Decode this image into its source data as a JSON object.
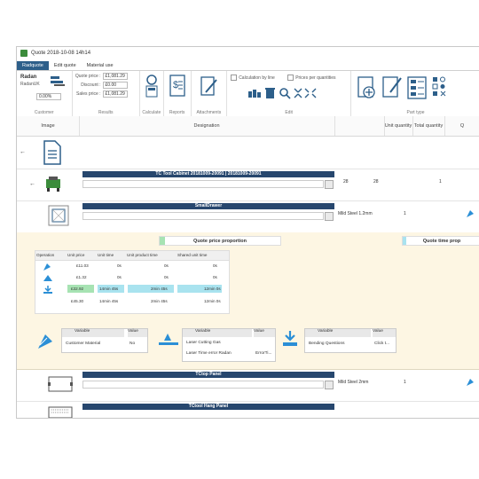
{
  "window": {
    "title": "Quote 2018-10-08 14h14"
  },
  "menu_tabs": [
    {
      "label": "Radquote",
      "active": true
    },
    {
      "label": "Edit quote",
      "active": false
    },
    {
      "label": "Material use",
      "active": false
    }
  ],
  "customer": {
    "name": "Radan",
    "sub": "RadanUK",
    "percent": "0.00%",
    "group_label": "Customer"
  },
  "results": {
    "quote_price_label": "Quote price :",
    "quote_price_value": "£1,081.29",
    "discount_label": "Discount :",
    "discount_value": "£0.00",
    "sales_price_label": "Sales price :",
    "sales_price_value": "£1,081.29",
    "group_label": "Results"
  },
  "ribbon_groups": {
    "calculate": "Calculate",
    "reports": "Reports",
    "attachments": "Attachments",
    "edit": "Edit",
    "part_type": "Part type"
  },
  "options": {
    "calc_by_line": "Calculation by line",
    "prices_per_qty": "Prices per quantities"
  },
  "grid_headers": {
    "image": "Image",
    "designation": "Designation",
    "unit_quantity": "Unit quantity",
    "total_quantity": "Total quantity",
    "more": "Q"
  },
  "rows": {
    "assembly": {
      "title": "TC Tool Cabinet 20181009-20091 | 20181009-20091",
      "unit_qty": "28",
      "total_qty": "28",
      "c1": "1"
    },
    "part1": {
      "title": "SmallDrawer",
      "material": "Mild Steel 1.2mm",
      "qty": "1"
    },
    "part2": {
      "title": "TCtop Panel",
      "material": "Mild Steel 2mm",
      "qty": "1"
    },
    "part3": {
      "title": "TCtool Hang Panel"
    }
  },
  "panel": {
    "price_proportion": "Quote price proportion",
    "time_proportion": "Quote time prop",
    "op_headers": {
      "operation": "Operation",
      "unit_price": "Unit price",
      "unit_time": "Unit time",
      "unit_product_time": "Unit product time",
      "shared_unit_time": "Shared unit time"
    },
    "op_rows": [
      {
        "price": "£11.03",
        "time": "0s",
        "ptime": "0s",
        "stime": "0s"
      },
      {
        "price": "£1.32",
        "time": "0s",
        "ptime": "0s",
        "stime": "0s"
      },
      {
        "price": "£32.92",
        "time": "14min 45s",
        "ptime": "2min 45s",
        "stime": "12min 0s"
      },
      {
        "price": "£45.30",
        "time": "14min 45s",
        "ptime": "2min 45s",
        "stime": "12min 0s"
      }
    ],
    "var_tables": [
      {
        "h1": "Variable",
        "h2": "Value",
        "rows": [
          [
            "Customer Material",
            "No"
          ]
        ]
      },
      {
        "h1": "Variable",
        "h2": "Value",
        "rows": [
          [
            "Laser Cutting Gas",
            ""
          ],
          [
            "Laser Time error Radan",
            "ErrorTi..."
          ]
        ]
      },
      {
        "h1": "Variable",
        "h2": "Value",
        "rows": [
          [
            "Bending Questions",
            "Click t..."
          ]
        ]
      }
    ]
  },
  "colors": {
    "accent": "#27476e",
    "tab_active": "#2d5f8a",
    "highlight": "#a9e3ef",
    "panel_bg": "#fdf6e3",
    "bar_green": "#a7e3b3"
  }
}
